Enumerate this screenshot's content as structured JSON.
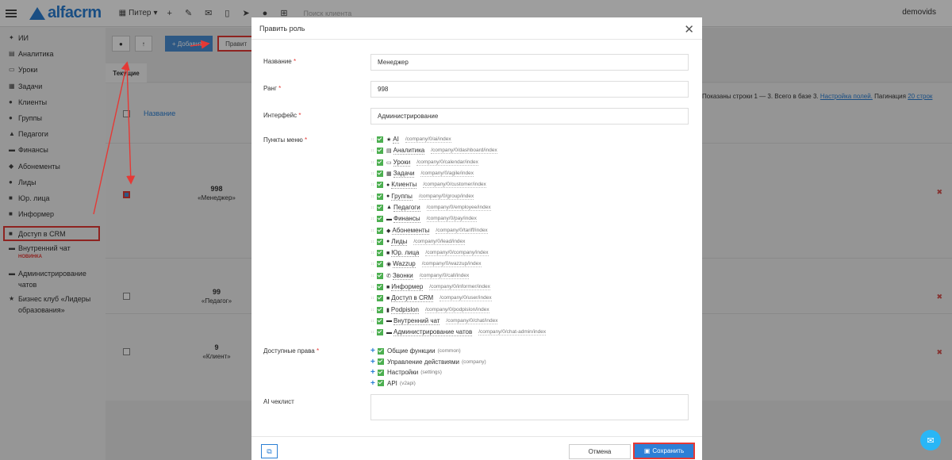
{
  "topbar": {
    "brand": "alfacrm",
    "branch": "Питер",
    "search_placeholder": "Поиск клиента",
    "user": "demovids"
  },
  "sidebar": {
    "items": [
      {
        "icon": "sparkle-icon",
        "label": "ИИ"
      },
      {
        "icon": "chart-icon",
        "label": "Аналитика"
      },
      {
        "icon": "calendar-icon",
        "label": "Уроки"
      },
      {
        "icon": "tasks-icon",
        "label": "Задачи"
      },
      {
        "icon": "user-icon",
        "label": "Клиенты"
      },
      {
        "icon": "users-icon",
        "label": "Группы"
      },
      {
        "icon": "graduation-cap-icon",
        "label": "Педагоги"
      },
      {
        "icon": "money-icon",
        "label": "Финансы"
      },
      {
        "icon": "tag-icon",
        "label": "Абонементы"
      },
      {
        "icon": "user-plus-icon",
        "label": "Лиды"
      },
      {
        "icon": "briefcase-icon",
        "label": "Юр. лица"
      },
      {
        "icon": "info-icon",
        "label": "Информер"
      },
      {
        "icon": "lock-icon",
        "label": "Доступ в CRM"
      },
      {
        "icon": "chat-icon",
        "label": "Внутренний чат",
        "badge": "НОВИНКА"
      },
      {
        "icon": "chat-admin-icon",
        "label": "Администрирование чатов"
      },
      {
        "icon": "star-icon",
        "label": "Бизнес клуб «Лидеры образования»"
      }
    ]
  },
  "toolbar": {
    "add_label": "+ Добавить",
    "edit_label": "Правит"
  },
  "tabs": {
    "current": "Текущие"
  },
  "grid": {
    "column_name": "Название",
    "info_prefix": "Показаны строки 1 — 3. Всего в базе 3.",
    "fields_link": "Настройка полей.",
    "pagination_label": "Пагинация",
    "pagination_value": "20 строк",
    "rows": [
      {
        "rank": "998",
        "name": "«Менеджер»"
      },
      {
        "rank": "99",
        "name": "«Педагог»"
      },
      {
        "rank": "9",
        "name": "«Клиент»"
      }
    ]
  },
  "modal": {
    "title": "Править роль",
    "fields": {
      "name_label": "Название",
      "name_value": "Менеджер",
      "rank_label": "Ранг",
      "rank_value": "998",
      "interface_label": "Интерфейс",
      "interface_value": "Администрирование",
      "menu_label": "Пункты меню",
      "rights_label": "Доступные права",
      "ai_checklist_label": "AI чеклист"
    },
    "menu_items": [
      {
        "icon": "star-icon",
        "glyph": "★",
        "name": "AI",
        "url": "/company/0/ai/index"
      },
      {
        "icon": "chart-icon",
        "glyph": "▤",
        "name": "Аналитика",
        "url": "/company/0/dashboard/index"
      },
      {
        "icon": "calendar-icon",
        "glyph": "▭",
        "name": "Уроки",
        "url": "/company/0/calendar/index"
      },
      {
        "icon": "tasks-icon",
        "glyph": "▦",
        "name": "Задачи",
        "url": "/company/0/agile/index"
      },
      {
        "icon": "user-icon",
        "glyph": "●",
        "name": "Клиенты",
        "url": "/company/0/customer/index"
      },
      {
        "icon": "users-icon",
        "glyph": "●",
        "name": "Группы",
        "url": "/company/0/group/index"
      },
      {
        "icon": "graduation-cap-icon",
        "glyph": "▲",
        "name": "Педагоги",
        "url": "/company/0/employee/index"
      },
      {
        "icon": "money-icon",
        "glyph": "▬",
        "name": "Финансы",
        "url": "/company/0/pay/index"
      },
      {
        "icon": "tag-icon",
        "glyph": "◆",
        "name": "Абонементы",
        "url": "/company/0/tariff/index"
      },
      {
        "icon": "user-plus-icon",
        "glyph": "●",
        "name": "Лиды",
        "url": "/company/0/lead/index"
      },
      {
        "icon": "briefcase-icon",
        "glyph": "■",
        "name": "Юр. лица",
        "url": "/company/0/company/index"
      },
      {
        "icon": "whatsapp-icon",
        "glyph": "◉",
        "name": "Wazzup",
        "url": "/company/0/wazzup/index"
      },
      {
        "icon": "phone-icon",
        "glyph": "✆",
        "name": "Звонки",
        "url": "/company/0/call/index"
      },
      {
        "icon": "info-icon",
        "glyph": "■",
        "name": "Информер",
        "url": "/company/0/informer/index"
      },
      {
        "icon": "lock-icon",
        "glyph": "■",
        "name": "Доступ в CRM",
        "url": "/company/0/user/index"
      },
      {
        "icon": "file-icon",
        "glyph": "▮",
        "name": "Podpislon",
        "url": "/company/0/podpislon/index"
      },
      {
        "icon": "chat-icon",
        "glyph": "▬",
        "name": "Внутренний чат",
        "url": "/company/0/chat/index"
      },
      {
        "icon": "chat-admin-icon",
        "glyph": "▬",
        "name": "Администрирование чатов",
        "url": "/company/0/chat-admin/index"
      }
    ],
    "rights": [
      {
        "name": "Общие функции",
        "code": "(common)"
      },
      {
        "name": "Управление действиями",
        "code": "(company)"
      },
      {
        "name": "Настройки",
        "code": "(settings)"
      },
      {
        "name": "API",
        "code": "(v2api)"
      }
    ],
    "cancel_label": "Отмена",
    "save_label": "Сохранить"
  },
  "colors": {
    "accent": "#2a7fd4",
    "highlight": "#e53935",
    "check": "#4caf50"
  }
}
